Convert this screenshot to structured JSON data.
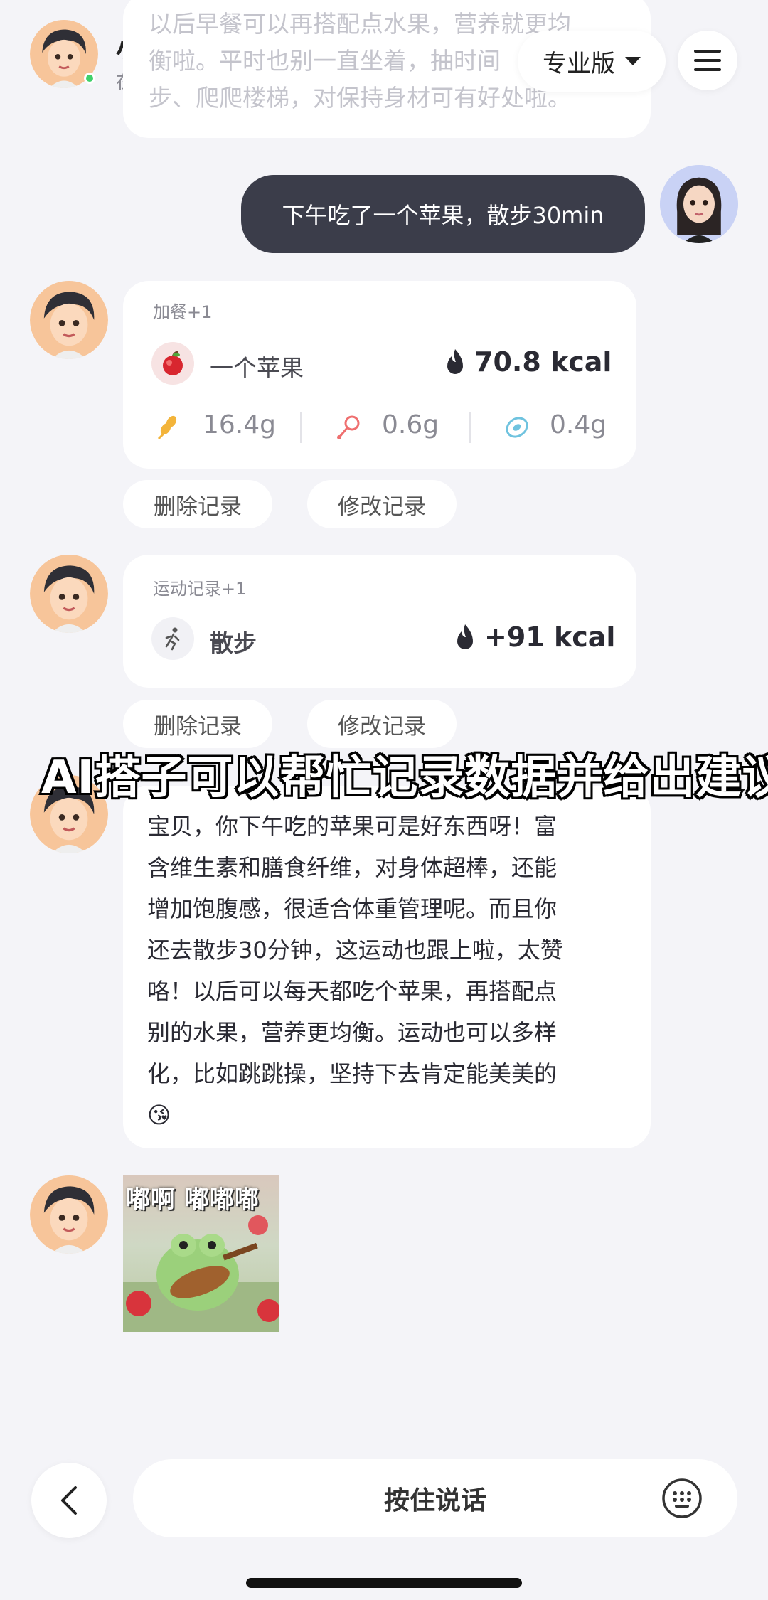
{
  "header": {
    "name": "小卡",
    "status": "在线",
    "version_label": "专业版"
  },
  "previous_message_fragment": [
    "以后早餐可以再搭配点水果，营养就更均",
    "衡啦。平时也别一直坐着，抽时间",
    "步、爬爬楼梯，对保持身材可有好处啦。"
  ],
  "user_message": "下午吃了一个苹果，散步30min",
  "meal_card": {
    "label": "加餐+1",
    "food_name": "一个苹果",
    "kcal": "70.8 kcal",
    "nutrients": [
      {
        "icon": "carb-icon",
        "value": "16.4g"
      },
      {
        "icon": "protein-icon",
        "value": "0.6g"
      },
      {
        "icon": "fat-icon",
        "value": "0.4g"
      }
    ]
  },
  "meal_actions": {
    "delete": "删除记录",
    "edit": "修改记录"
  },
  "exercise_card": {
    "label": "运动记录+1",
    "name": "散步",
    "kcal": "+91 kcal"
  },
  "exercise_actions": {
    "delete": "删除记录",
    "edit": "修改记录"
  },
  "overlay_caption": "AI搭子可以帮忙记录数据并给出建议",
  "reply": {
    "lines": [
      "宝贝，你下午吃的苹果可是好东西呀！富",
      "含维生素和膳食纤维，对身体超棒，还能",
      "增加饱腹感，很适合体重管理呢。而且你",
      "还去散步30分钟，这运动也跟上啦，太赞",
      "咯！以后可以每天都吃个苹果，再搭配点",
      "别的水果，营养更均衡。运动也可以多样",
      "化，比如跳跳操，坚持下去肯定能美美的"
    ],
    "emoji": "😘"
  },
  "sticker": {
    "caption": "嘟啊 嘟嘟嘟"
  },
  "bottom_bar": {
    "talk_label": "按住说话"
  },
  "colors": {
    "background": "#f4f4f8",
    "user_bubble": "#3b3d4a",
    "online": "#3fd16b"
  }
}
